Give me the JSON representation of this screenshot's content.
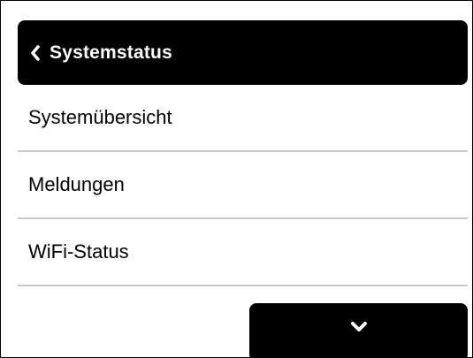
{
  "header": {
    "title": "Systemstatus",
    "back_icon": "chevron-left-icon"
  },
  "menu": {
    "items": [
      {
        "label": "Systemübersicht"
      },
      {
        "label": "Meldungen"
      },
      {
        "label": "WiFi-Status"
      }
    ]
  },
  "scroll_button": {
    "icon": "chevron-down-icon"
  },
  "colors": {
    "bar": "#000000",
    "divider": "#c8c8c8",
    "text": "#000000",
    "bar_text": "#ffffff"
  }
}
